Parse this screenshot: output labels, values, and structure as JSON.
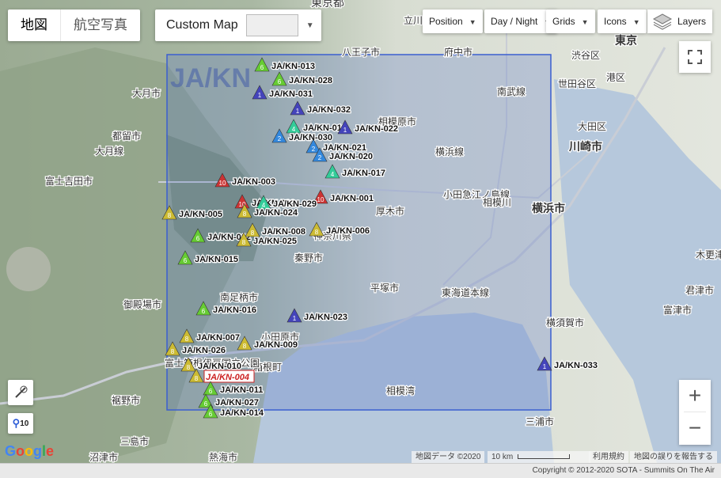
{
  "controls": {
    "map_type": [
      "地図",
      "航空写真"
    ],
    "custom_map": "Custom Map",
    "menus": [
      "Position",
      "Day / Night",
      "Grids",
      "Icons"
    ],
    "layers": "Layers",
    "zoom_level": "10",
    "zoom_in": "+",
    "zoom_out": "−"
  },
  "region_label": "JA/KN",
  "place_labels": [
    "東京都",
    "立川市",
    "八王子市",
    "府中市",
    "渋谷区",
    "東京",
    "世田谷区",
    "港区",
    "大田区",
    "川崎市",
    "横浜市",
    "相模原市",
    "南武線",
    "横浜線",
    "厚木市",
    "秦野市",
    "平塚市",
    "小田原市",
    "東海道本線",
    "横須賀市",
    "三浦市",
    "富士吉田市",
    "都留市",
    "大月市",
    "御殿場市",
    "裾野市",
    "三島市",
    "沼津市",
    "熱海市",
    "南足柄市",
    "箱根町",
    "相模湾",
    "富士箱根伊豆国立公園",
    "神奈川県",
    "小田急江ノ島線",
    "君津市",
    "富津市",
    "木更津",
    "大月線",
    "相模川"
  ],
  "summits": [
    {
      "ref": "JA/KN-013",
      "pts": "6",
      "c": "#6c3"
    },
    {
      "ref": "JA/KN-028",
      "pts": "6",
      "c": "#6c3"
    },
    {
      "ref": "JA/KN-031",
      "pts": "1",
      "c": "#44b"
    },
    {
      "ref": "JA/KN-032",
      "pts": "1",
      "c": "#44b"
    },
    {
      "ref": "JA/KN-018",
      "pts": "4",
      "c": "#3c9"
    },
    {
      "ref": "JA/KN-022",
      "pts": "1",
      "c": "#44b"
    },
    {
      "ref": "JA/KN-030",
      "pts": "2",
      "c": "#38d"
    },
    {
      "ref": "JA/KN-021",
      "pts": "2",
      "c": "#38d"
    },
    {
      "ref": "JA/KN-020",
      "pts": "2",
      "c": "#38d"
    },
    {
      "ref": "JA/KN-017",
      "pts": "4",
      "c": "#3c9"
    },
    {
      "ref": "JA/KN-003",
      "pts": "10",
      "c": "#c33"
    },
    {
      "ref": "JA/KN-001",
      "pts": "10",
      "c": "#c33"
    },
    {
      "ref": "JA/KN-002",
      "pts": "10",
      "c": "#c33"
    },
    {
      "ref": "JA/KN-029",
      "pts": "4",
      "c": "#3c9"
    },
    {
      "ref": "JA/KN-005",
      "pts": "8",
      "c": "#cb3"
    },
    {
      "ref": "JA/KN-024",
      "pts": "8",
      "c": "#cb3"
    },
    {
      "ref": "JA/KN-012",
      "pts": "6",
      "c": "#6c3"
    },
    {
      "ref": "JA/KN-008",
      "pts": "8",
      "c": "#cb3"
    },
    {
      "ref": "JA/KN-025",
      "pts": "8",
      "c": "#cb3"
    },
    {
      "ref": "JA/KN-006",
      "pts": "8",
      "c": "#cb3"
    },
    {
      "ref": "JA/KN-015",
      "pts": "6",
      "c": "#6c3"
    },
    {
      "ref": "JA/KN-016",
      "pts": "6",
      "c": "#6c3"
    },
    {
      "ref": "JA/KN-023",
      "pts": "1",
      "c": "#44b"
    },
    {
      "ref": "JA/KN-007",
      "pts": "8",
      "c": "#cb3"
    },
    {
      "ref": "JA/KN-026",
      "pts": "8",
      "c": "#cb3"
    },
    {
      "ref": "JA/KN-009",
      "pts": "8",
      "c": "#cb3"
    },
    {
      "ref": "JA/KN-004",
      "pts": "8",
      "c": "#cb3",
      "activated": true
    },
    {
      "ref": "JA/KN-010",
      "pts": "8",
      "c": "#cb3"
    },
    {
      "ref": "JA/KN-011",
      "pts": "6",
      "c": "#6c3"
    },
    {
      "ref": "JA/KN-027",
      "pts": "6",
      "c": "#6c3"
    },
    {
      "ref": "JA/KN-014",
      "pts": "6",
      "c": "#6c3"
    },
    {
      "ref": "JA/KN-033",
      "pts": "1",
      "c": "#44b"
    }
  ],
  "attribution": {
    "map_data": "地図データ ©2020",
    "scale": "10 km",
    "terms": "利用規約",
    "report": "地図の誤りを報告する",
    "google": "Google"
  },
  "copyright": "Copyright © 2012-2020 SOTA - Summits On The Air"
}
